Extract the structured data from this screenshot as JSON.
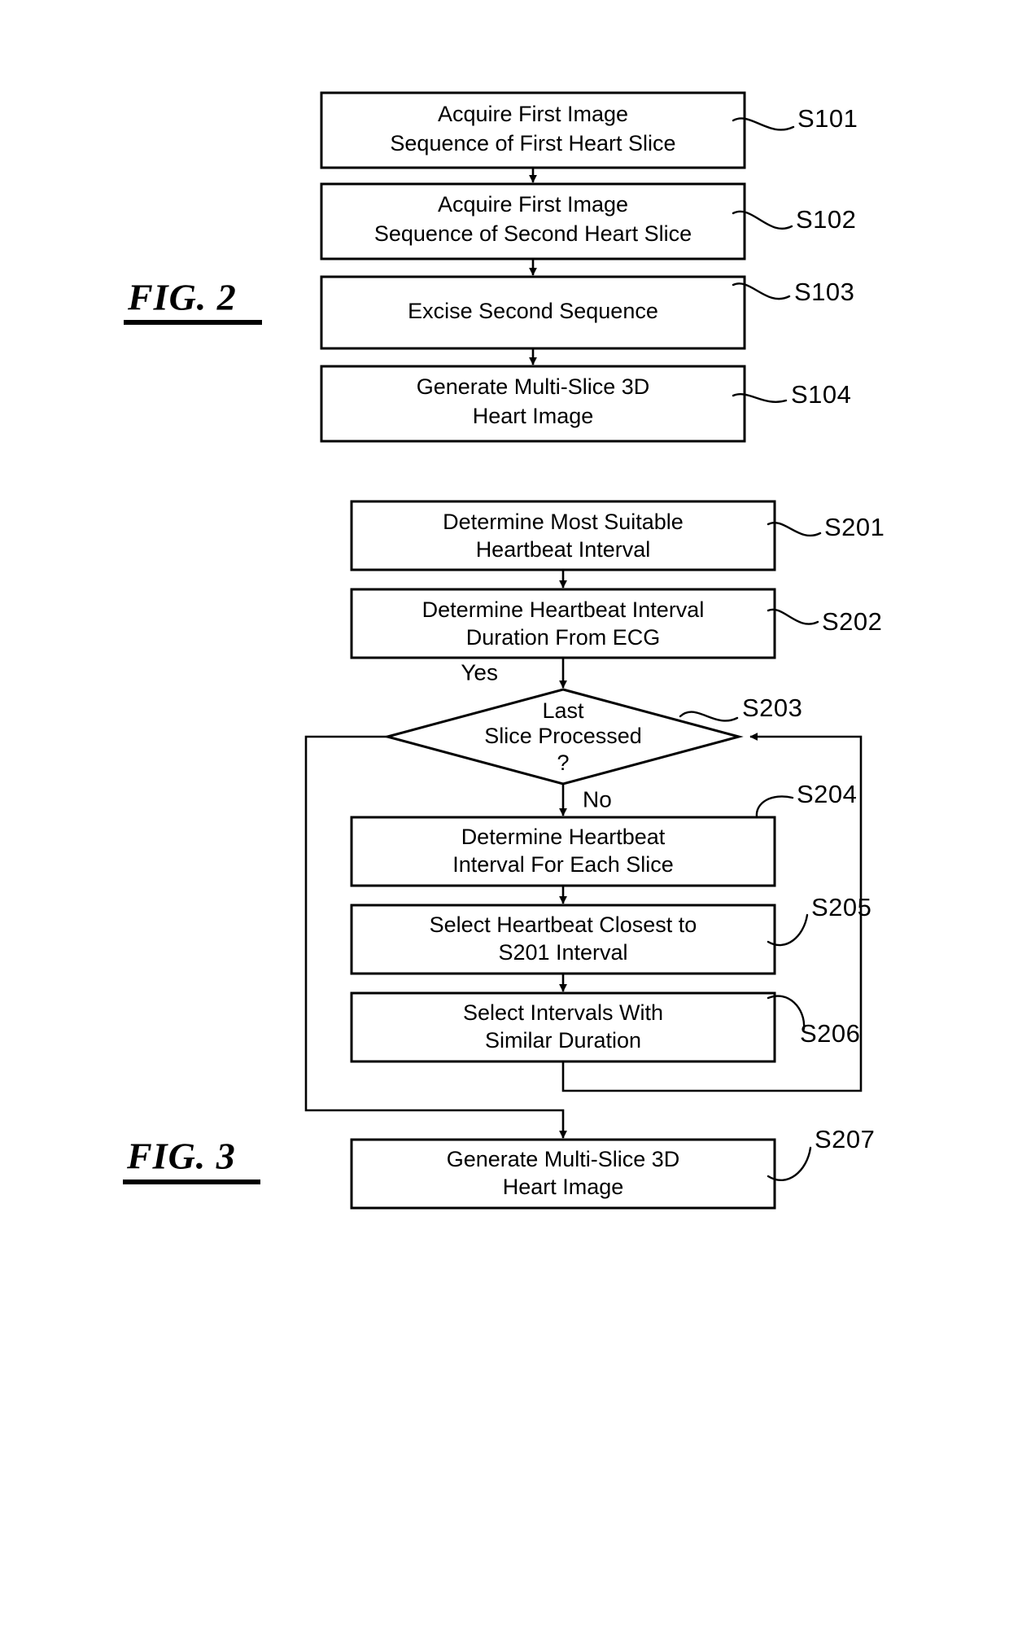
{
  "document": {
    "kind": "patent-flowchart-sheet",
    "background_color": "#ffffff",
    "ink_color": "#000000"
  },
  "figures": [
    {
      "id": "fig2",
      "caption": "FIG. 2",
      "steps": [
        {
          "ref": "S101",
          "lines": [
            "Acquire First Image",
            "Sequence of First Heart Slice"
          ]
        },
        {
          "ref": "S102",
          "lines": [
            "Acquire First Image",
            "Sequence of Second Heart Slice"
          ]
        },
        {
          "ref": "S103",
          "lines": [
            "Excise Second Sequence"
          ]
        },
        {
          "ref": "S104",
          "lines": [
            "Generate Multi-Slice 3D",
            "Heart Image"
          ]
        }
      ]
    },
    {
      "id": "fig3",
      "caption": "FIG. 3",
      "branch_yes": "Yes",
      "branch_no": "No",
      "steps": [
        {
          "ref": "S201",
          "lines": [
            "Determine Most Suitable",
            "Heartbeat Interval"
          ]
        },
        {
          "ref": "S202",
          "lines": [
            "Determine Heartbeat Interval",
            "Duration From ECG"
          ]
        },
        {
          "ref": "S203",
          "shape": "decision",
          "lines": [
            "Last",
            "Slice Processed",
            "?"
          ]
        },
        {
          "ref": "S204",
          "lines": [
            "Determine Heartbeat",
            "Interval For Each Slice"
          ]
        },
        {
          "ref": "S205",
          "lines": [
            "Select Heartbeat Closest to",
            "S201 Interval"
          ]
        },
        {
          "ref": "S206",
          "lines": [
            "Select Intervals With",
            "Similar Duration"
          ]
        },
        {
          "ref": "S207",
          "lines": [
            "Generate Multi-Slice 3D",
            "Heart Image"
          ]
        }
      ]
    }
  ]
}
